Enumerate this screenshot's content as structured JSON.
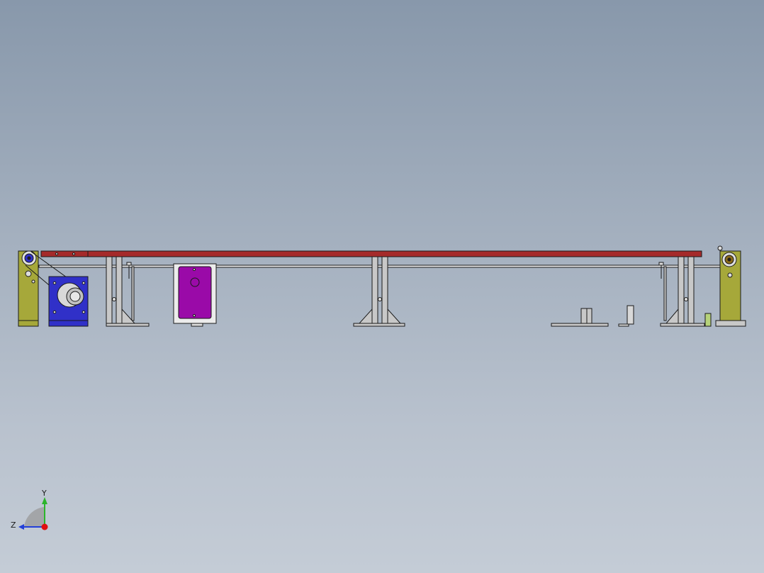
{
  "viewport": {
    "background_top": "#8898ab",
    "background_bottom": "#c4ccd6"
  },
  "model": {
    "colors": {
      "belt": "#a52a2a",
      "frame_yellow": "#a6a83a",
      "motor_blue": "#3030c8",
      "box_purple": "#9a0aa8",
      "steel": "#c8c8c8",
      "outline": "#1a1a1a",
      "green_part": "#b6d27a"
    }
  },
  "triad": {
    "y_label": "Y",
    "z_label": "Z",
    "y_color": "#2bb52b",
    "z_color": "#2340d8",
    "x_color": "#e01010"
  }
}
